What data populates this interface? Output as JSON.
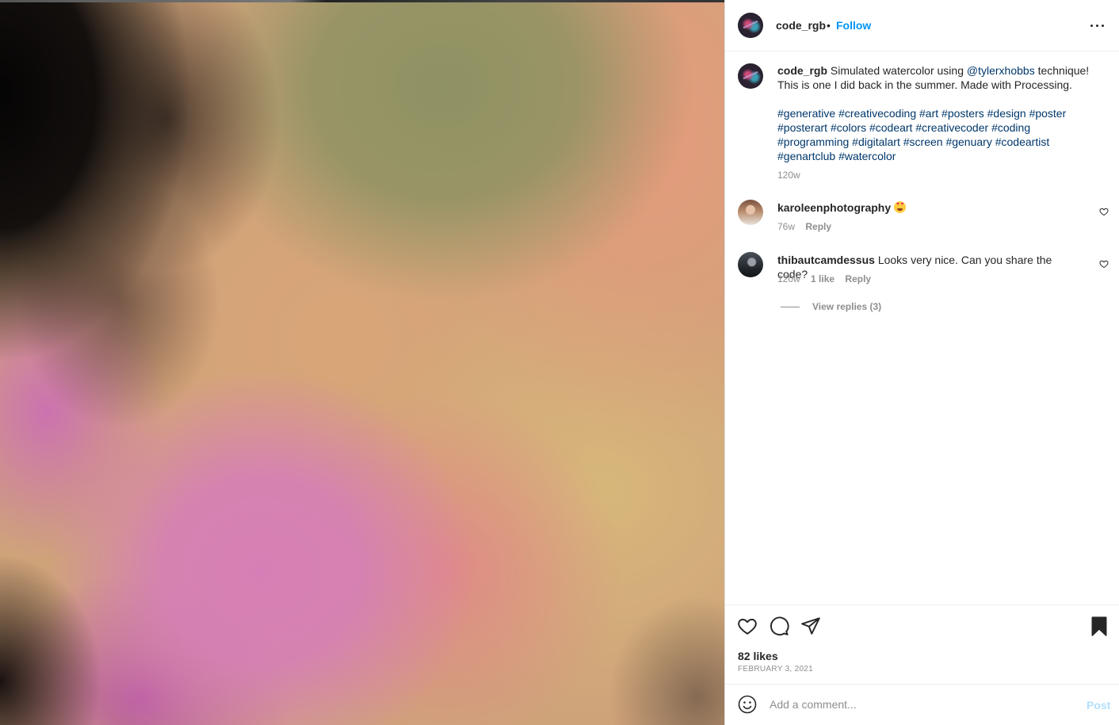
{
  "post": {
    "image_alt": "Simulated watercolor artwork",
    "owner": {
      "username": "code_rgb",
      "dot": "•",
      "follow_label": "Follow"
    },
    "caption": {
      "username": "code_rgb",
      "text_before": " Simulated watercolor using ",
      "mention": "@tylerxhobbs",
      "text_after": " technique!",
      "line2": "This is one I did back in the summer. Made with Processing.",
      "hashtag_lines": [
        [
          "#generative",
          "#creativecoding",
          "#art",
          "#posters",
          "#design",
          "#poster"
        ],
        [
          "#posterart",
          "#colors",
          "#codeart",
          "#creativecoder",
          "#coding"
        ],
        [
          "#programming",
          "#digitalart",
          "#screen",
          "#genuary",
          "#codeartist"
        ],
        [
          "#genartclub",
          "#watercolor"
        ]
      ],
      "time": "120w"
    },
    "comments": [
      {
        "username": "karoleenphotography",
        "text": "",
        "emoji": "smiling-face-with-heart-eyes",
        "time": "76w",
        "likes": "",
        "reply_label": "Reply"
      },
      {
        "username": "thibautcamdessus",
        "text": "Looks very nice. Can you share the code?",
        "time": "120w",
        "likes": "1 like",
        "reply_label": "Reply"
      }
    ],
    "view_replies": "View replies (3)",
    "likes": "82 likes",
    "date": "FEBRUARY 3, 2021",
    "comment_placeholder": "Add a comment...",
    "post_label": "Post"
  },
  "colors": {
    "link": "#0095f6",
    "mention": "#00376b",
    "muted": "#8e8e8e",
    "post_disabled": "#b2dffc"
  },
  "icons": [
    "more-icon",
    "heart-icon",
    "comment-icon",
    "share-icon",
    "bookmark-icon",
    "emoji-icon"
  ]
}
